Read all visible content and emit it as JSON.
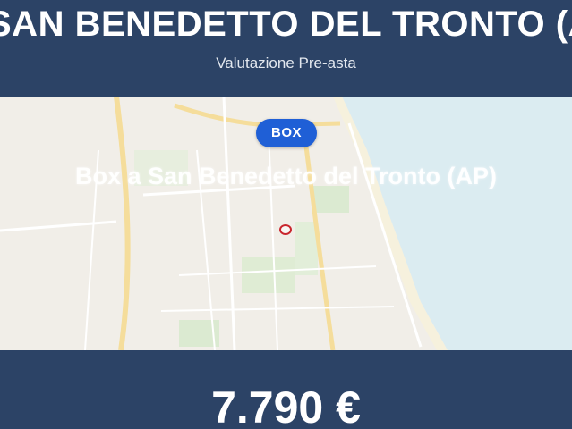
{
  "header": {
    "title": "SAN BENEDETTO DEL TRONTO (AP)",
    "subtitle": "Valutazione Pre-asta"
  },
  "map": {
    "badge": "BOX",
    "caption": "Box a San Benedetto del Tronto (AP)",
    "pin_icon": "location-pin-icon"
  },
  "footer": {
    "price": "7.790 €"
  },
  "colors": {
    "header_bg": "#2c4366",
    "badge_bg": "#1f5fd6",
    "pin": "#c9262e",
    "sea": "#cfe6ec",
    "land": "#ece9e0"
  }
}
